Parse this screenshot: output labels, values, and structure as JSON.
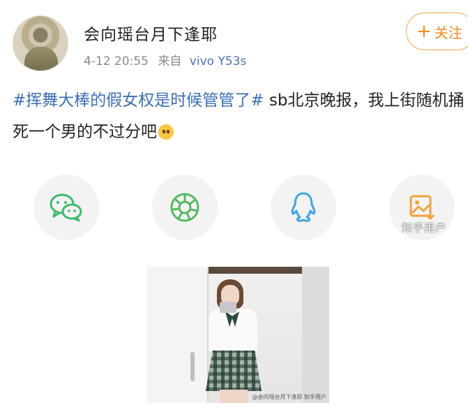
{
  "post": {
    "author": "会向瑶台月下逢耶",
    "time": "4-12 20:55",
    "source_prefix": "来自",
    "device": "vivo Y53s",
    "follow_label": "关注",
    "follow_plus": "+",
    "hashtag": "#挥舞大棒的假女权是时候管管了#",
    "body_text": " sb北京晚报，我上街随机捅死一个男的不过分吧"
  },
  "share": {
    "items": [
      {
        "icon": "wechat-icon"
      },
      {
        "icon": "moments-icon"
      },
      {
        "icon": "qq-icon"
      },
      {
        "icon": "save-image-icon"
      }
    ]
  },
  "watermark": "知乎用户",
  "photo": {
    "caption": "@会向瑶台月下逢耶 知乎用户"
  },
  "colors": {
    "hashtag": "#3b6fb6",
    "device": "#4a73b8",
    "follow": "#f08a1c",
    "wechat": "#3dbb6e",
    "moments": "#56b964",
    "qq": "#3fa3e8",
    "save": "#f0a23a"
  }
}
